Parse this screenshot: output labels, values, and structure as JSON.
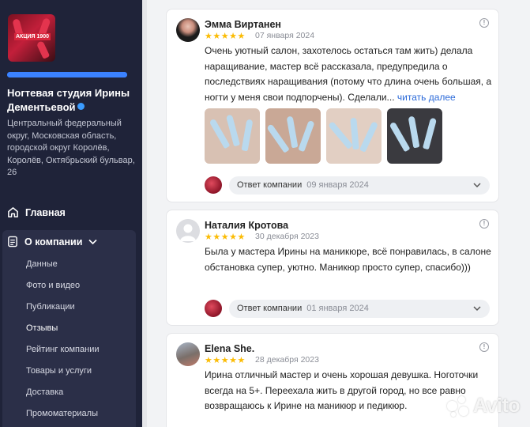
{
  "sidebar": {
    "logo_text": "АКЦИЯ 1900",
    "progress": 1.0,
    "org_name": "Ногтевая студия Ирины Дементьевой",
    "address": "Центральный федеральный округ, Московская область, городской округ Королёв, Королёв, Октябрьский бульвар, 26",
    "nav_main": "Главная",
    "nav_section": "О компании",
    "sub_items": [
      "Данные",
      "Фото и видео",
      "Публикации",
      "Отзывы",
      "Рейтинг компании",
      "Товары и услуги",
      "Доставка",
      "Промоматериалы"
    ],
    "active_sub_item": "Отзывы"
  },
  "reviews": [
    {
      "name": "Эмма Виртанен",
      "stars": "★★★★★",
      "rating": 5,
      "date": "07 января 2024",
      "text": "Очень уютный салон, захотелось остаться там жить) делала наращивание, мастер всё рассказала, предупредила о последствиях наращивания (потому что длина очень большая, а ногти у меня свои подпорчены). Сделали...",
      "read_more": "читать далее",
      "reply_label": "Ответ компании",
      "reply_date": "09 января 2024"
    },
    {
      "name": "Наталия Кротова",
      "stars": "★★★★★",
      "rating": 5,
      "date": "30 декабря 2023",
      "text": "Была у мастера Ирины на маникюре, всё понравилась, в салоне обстановка супер, уютно. Маникюр просто супер, спасибо)))",
      "reply_label": "Ответ компании",
      "reply_date": "01 января 2024"
    },
    {
      "name": "Elena She.",
      "stars": "★★★★★",
      "rating": 5,
      "date": "28 декабря 2023",
      "text": "Ирина отличный мастер и очень хорошая девушка. Ноготочки всегда на 5+. Переехала жить в другой город, но все равно возвращаюсь к Ирине на маникюр и педикюр."
    }
  ],
  "icons": {
    "home": "home-icon",
    "document": "document-icon",
    "info": "info-icon",
    "chevron": "chevron-down-icon"
  },
  "watermark": "Avito",
  "colors": {
    "sidebar_bg": "#1f2339",
    "accent_blue": "#2b6ad9",
    "star": "#fbbc05"
  }
}
